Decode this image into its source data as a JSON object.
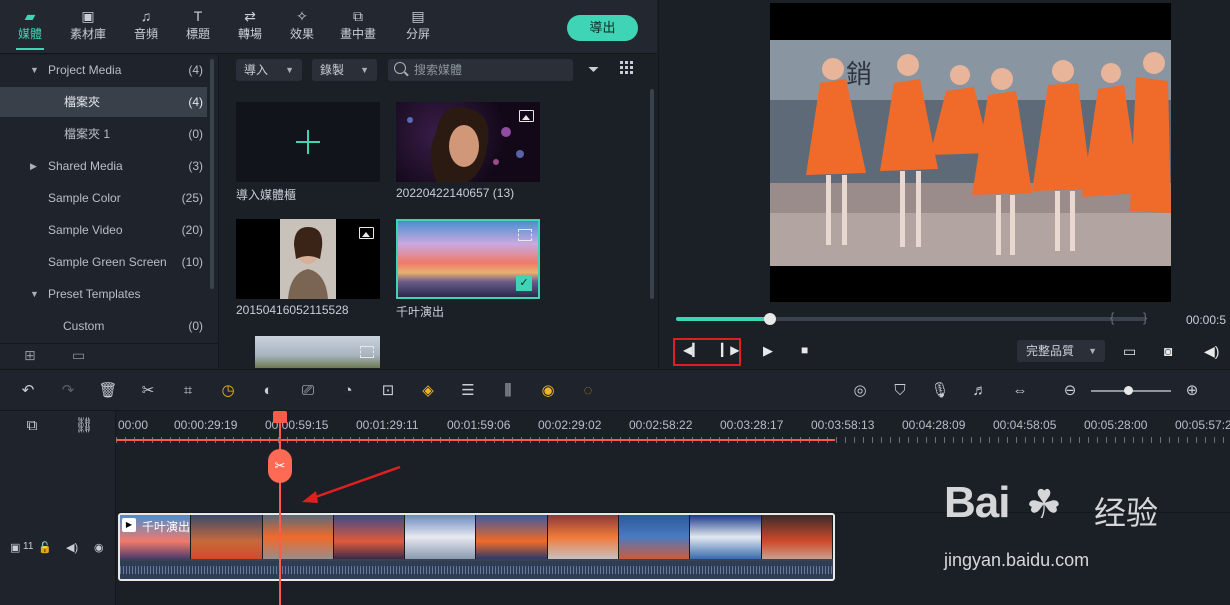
{
  "top_tabs": [
    {
      "label": "媒體",
      "icon": "folder-icon"
    },
    {
      "label": "素材庫",
      "icon": "image-icon"
    },
    {
      "label": "音頻",
      "icon": "music-note-icon"
    },
    {
      "label": "標題",
      "icon": "text-icon"
    },
    {
      "label": "轉場",
      "icon": "transition-icon"
    },
    {
      "label": "效果",
      "icon": "effects-icon"
    },
    {
      "label": "畫中畫",
      "icon": "pip-icon"
    },
    {
      "label": "分屏",
      "icon": "split-screen-icon"
    }
  ],
  "export_label": "導出",
  "sidebar": {
    "items": [
      {
        "label": "Project Media",
        "count": "(4)"
      },
      {
        "label": "檔案夾",
        "count": "(4)"
      },
      {
        "label": "檔案夾 1",
        "count": "(0)"
      },
      {
        "label": "Shared Media",
        "count": "(3)"
      },
      {
        "label": "Sample Color",
        "count": "(25)"
      },
      {
        "label": "Sample Video",
        "count": "(20)"
      },
      {
        "label": "Sample Green Screen",
        "count": "(10)"
      },
      {
        "label": "Preset Templates",
        "count": ""
      },
      {
        "label": "Custom",
        "count": "(0)"
      }
    ]
  },
  "media": {
    "import_label": "導入",
    "record_label": "錄製",
    "search_placeholder": "搜索媒體",
    "items": [
      {
        "label": "導入媒體櫃"
      },
      {
        "label": "20220422140657 (13)"
      },
      {
        "label": "20150416052115528"
      },
      {
        "label": "千叶演出"
      }
    ]
  },
  "preview": {
    "timecode": "00:00:5",
    "quality_label": "完整品質",
    "progress": 0.2
  },
  "timeline": {
    "ruler_labels": [
      "00:00",
      "00:00:29:19",
      "00:00:59:15",
      "00:01:29:11",
      "00:01:59:06",
      "00:02:29:02",
      "00:02:58:22",
      "00:03:28:17",
      "00:03:58:13",
      "00:04:28:09",
      "00:04:58:05",
      "00:05:28:00",
      "00:05:57:2"
    ],
    "clip_title": "千叶演出",
    "track_number": "11"
  },
  "watermark": {
    "main": "Bai",
    "cn": "经验",
    "sub": "jingyan.baidu.com"
  },
  "colors": {
    "accent": "#3fd4b5",
    "playhead": "#ff5a4a",
    "annotation": "#e02020"
  }
}
